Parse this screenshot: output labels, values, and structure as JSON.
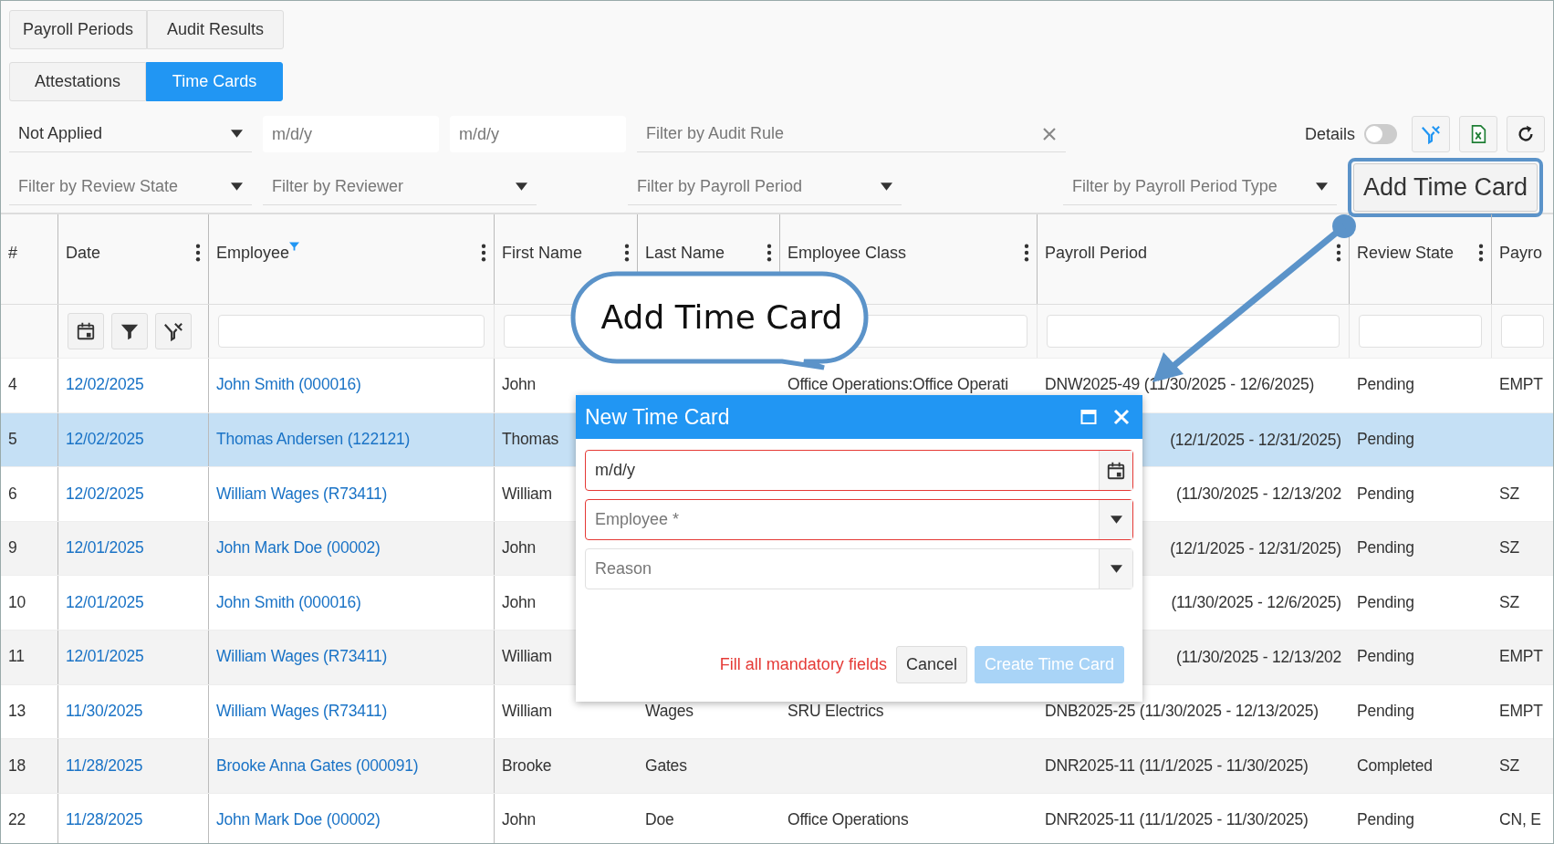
{
  "tab_rows": [
    [
      {
        "label": "Payroll Periods",
        "selected": false
      },
      {
        "label": "Audit Results",
        "selected": false
      }
    ],
    [
      {
        "label": "Attestations",
        "selected": false
      },
      {
        "label": "Time Cards",
        "selected": true
      }
    ]
  ],
  "filters_row_1": [
    {
      "kind": "select",
      "value": "Not Applied"
    },
    {
      "kind": "date",
      "placeholder": "m/d/y"
    },
    {
      "kind": "date",
      "placeholder": "m/d/y"
    },
    {
      "kind": "search",
      "placeholder": "Filter by Audit Rule"
    }
  ],
  "details_toggle": {
    "label": "Details",
    "on": false
  },
  "filters_row_2": [
    {
      "kind": "select",
      "placeholder": "Filter by Review State"
    },
    {
      "kind": "select",
      "placeholder": "Filter by Reviewer"
    },
    {
      "kind": "select",
      "placeholder": "Filter by Payroll Period"
    },
    {
      "kind": "select",
      "placeholder": "Filter by Payroll Period Type"
    }
  ],
  "add_button": {
    "label": "Add Time Card",
    "highlighted": true
  },
  "table": {
    "columns": [
      {
        "label": "#",
        "menu": false,
        "filtered": false
      },
      {
        "label": "Date",
        "menu": true,
        "filtered": false
      },
      {
        "label": "Employee",
        "menu": true,
        "filtered": true
      },
      {
        "label": "First Name",
        "menu": true,
        "filtered": false
      },
      {
        "label": "Last Name",
        "menu": true,
        "filtered": false
      },
      {
        "label": "Employee Class",
        "menu": true,
        "filtered": false
      },
      {
        "label": "Payroll Period",
        "menu": true,
        "filtered": false
      },
      {
        "label": "Review State",
        "menu": true,
        "filtered": false
      },
      {
        "label": "Payro",
        "menu": false,
        "filtered": false
      }
    ],
    "rows": [
      {
        "selected": false,
        "cells": [
          {
            "text": "4"
          },
          {
            "text": "12/02/2025",
            "link": true
          },
          {
            "text": "John Smith (000016)",
            "link": true
          },
          {
            "text": "John"
          },
          {},
          {
            "text": "Office Operations:Office Operati"
          },
          {
            "text": "DNW2025-49 (11/30/2025 - 12/6/2025)"
          },
          {
            "text": "Pending"
          },
          {
            "text": "EMPT"
          }
        ]
      },
      {
        "selected": true,
        "cells": [
          {
            "text": "5"
          },
          {
            "text": "12/02/2025",
            "link": true
          },
          {
            "text": "Thomas Andersen (122121)",
            "link": true
          },
          {
            "text": "Thomas"
          },
          {},
          {},
          {
            "text": "(12/1/2025 - 12/31/2025)",
            "clipped": true
          },
          {
            "text": "Pending"
          },
          {}
        ]
      },
      {
        "selected": false,
        "cells": [
          {
            "text": "6"
          },
          {
            "text": "12/02/2025",
            "link": true
          },
          {
            "text": "William Wages (R73411)",
            "link": true
          },
          {
            "text": "William"
          },
          {},
          {},
          {
            "text": "(11/30/2025 - 12/13/202",
            "clipped": true
          },
          {
            "text": "Pending"
          },
          {
            "text": "SZ"
          }
        ]
      },
      {
        "selected": false,
        "cells": [
          {
            "text": "9"
          },
          {
            "text": "12/01/2025",
            "link": true
          },
          {
            "text": "John Mark Doe (00002)",
            "link": true
          },
          {
            "text": "John"
          },
          {},
          {},
          {
            "text": "(12/1/2025 - 12/31/2025)",
            "clipped": true
          },
          {
            "text": "Pending"
          },
          {
            "text": "SZ"
          }
        ]
      },
      {
        "selected": false,
        "cells": [
          {
            "text": "10"
          },
          {
            "text": "12/01/2025",
            "link": true
          },
          {
            "text": "John Smith (000016)",
            "link": true
          },
          {
            "text": "John"
          },
          {},
          {},
          {
            "text": "(11/30/2025 - 12/6/2025)",
            "clipped": true
          },
          {
            "text": "Pending"
          },
          {
            "text": "SZ"
          }
        ]
      },
      {
        "selected": false,
        "cells": [
          {
            "text": "11"
          },
          {
            "text": "12/01/2025",
            "link": true
          },
          {
            "text": "William Wages (R73411)",
            "link": true
          },
          {
            "text": "William"
          },
          {},
          {},
          {
            "text": "(11/30/2025 - 12/13/202",
            "clipped": true
          },
          {
            "text": "Pending"
          },
          {
            "text": "EMPT"
          }
        ]
      },
      {
        "selected": false,
        "cells": [
          {
            "text": "13"
          },
          {
            "text": "11/30/2025",
            "link": true
          },
          {
            "text": "William Wages (R73411)",
            "link": true
          },
          {
            "text": "William"
          },
          {
            "text": "Wages"
          },
          {
            "text": "SRU Electrics"
          },
          {
            "text": "DNB2025-25 (11/30/2025 - 12/13/2025)"
          },
          {
            "text": "Pending"
          },
          {
            "text": "EMPT"
          }
        ]
      },
      {
        "selected": false,
        "cells": [
          {
            "text": "18"
          },
          {
            "text": "11/28/2025",
            "link": true
          },
          {
            "text": "Brooke Anna Gates (000091)",
            "link": true
          },
          {
            "text": "Brooke"
          },
          {
            "text": "Gates"
          },
          {},
          {
            "text": "DNR2025-11 (11/1/2025 - 11/30/2025)"
          },
          {
            "text": "Completed"
          },
          {
            "text": "SZ"
          }
        ]
      },
      {
        "selected": false,
        "cells": [
          {
            "text": "22"
          },
          {
            "text": "11/28/2025",
            "link": true
          },
          {
            "text": "John Mark Doe (00002)",
            "link": true
          },
          {
            "text": "John"
          },
          {
            "text": "Doe"
          },
          {
            "text": "Office Operations"
          },
          {
            "text": "DNR2025-11 (11/1/2025 - 11/30/2025)"
          },
          {
            "text": "Pending"
          },
          {
            "text": "CN, E"
          }
        ]
      }
    ]
  },
  "dialog": {
    "title": "New Time Card",
    "fields": [
      {
        "kind": "date",
        "placeholder": "m/d/y",
        "invalid": true
      },
      {
        "kind": "select",
        "placeholder": "Employee *",
        "invalid": true
      },
      {
        "kind": "select",
        "placeholder": "Reason",
        "invalid": false
      }
    ],
    "message": "Fill all mandatory fields",
    "buttons": [
      {
        "label": "Cancel",
        "kind": "secondary",
        "disabled": false
      },
      {
        "label": "Create Time Card",
        "kind": "primary",
        "disabled": true
      }
    ]
  },
  "callout": {
    "text": "Add Time Card"
  }
}
